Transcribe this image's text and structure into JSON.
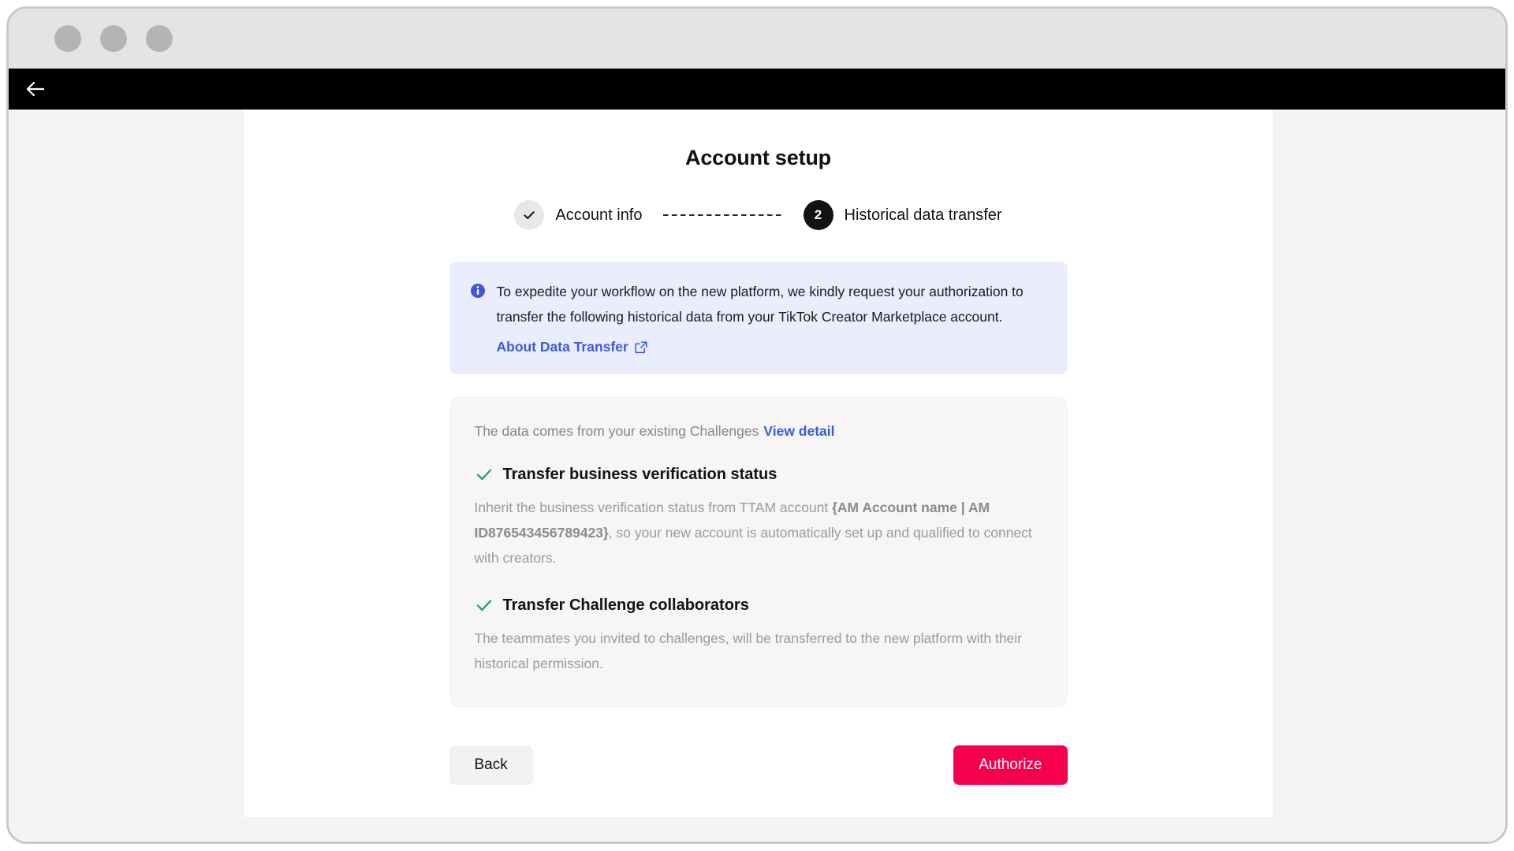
{
  "window": {
    "traffic_lights": [
      "close-dot",
      "minimize-dot",
      "maximize-dot"
    ],
    "topbar": {
      "back_icon": "arrow-left-icon"
    }
  },
  "page": {
    "title": "Account setup"
  },
  "stepper": {
    "steps": [
      {
        "id": "account-info",
        "marker": "check-icon",
        "state": "completed",
        "label": "Account info"
      },
      {
        "id": "historical-data-transfer",
        "marker": "2",
        "state": "current",
        "label": "Historical data transfer"
      }
    ],
    "connector": "dashed-line"
  },
  "info_banner": {
    "icon": "info-circle-icon",
    "icon_color": "#3b5bdb",
    "background": "#eaeefc",
    "text": "To expedite your workflow on the new platform, we kindly request your authorization to transfer the following historical data from your TikTok Creator Marketplace account.",
    "link_label": "About Data Transfer",
    "link_icon": "external-link-icon",
    "link_color": "#3b5bdb"
  },
  "data_card": {
    "source_text": "The data comes from your existing Challenges",
    "view_detail_label": "View detail",
    "items": [
      {
        "icon": "check-icon",
        "icon_color": "#22a06b",
        "title": "Transfer business verification status",
        "desc_before": "Inherit the business verification status from TTAM account ",
        "desc_strong": "{AM Account name | AM ID876543456789423}",
        "desc_after": ", so your new account is automatically set up and qualified to connect with creators."
      },
      {
        "icon": "check-icon",
        "icon_color": "#22a06b",
        "title": "Transfer Challenge collaborators",
        "desc_before": "The teammates you invited to challenges, will be transferred to the new platform with their historical permission.",
        "desc_strong": "",
        "desc_after": ""
      }
    ]
  },
  "footer": {
    "back_label": "Back",
    "authorize_label": "Authorize",
    "authorize_color": "#f5004f"
  }
}
